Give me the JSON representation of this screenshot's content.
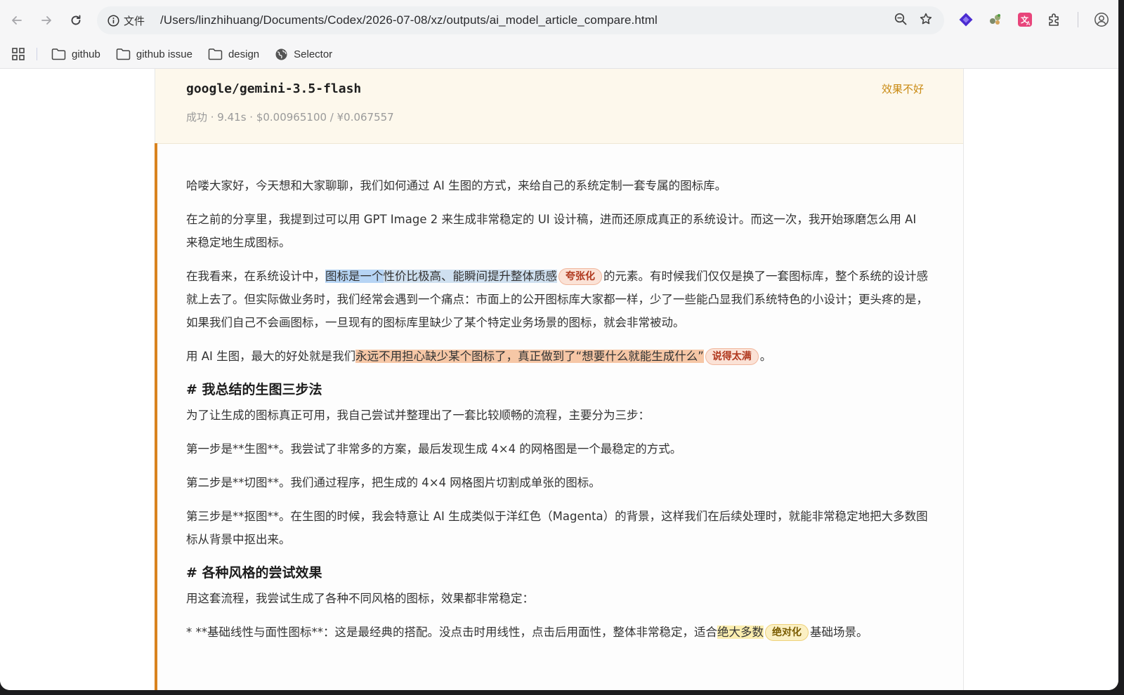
{
  "browser": {
    "scheme_label": "文件",
    "url": "/Users/linzhihuang/Documents/Codex/2026-07-08/xz/outputs/ai_model_article_compare.html"
  },
  "bookmarks": [
    {
      "label": "github",
      "icon": "folder-icon"
    },
    {
      "label": "github issue",
      "icon": "folder-icon"
    },
    {
      "label": "design",
      "icon": "folder-icon"
    },
    {
      "label": "Selector",
      "icon": "globe-icon"
    }
  ],
  "card": {
    "model": "google/gemini-3.5-flash",
    "verdict": "效果不好",
    "verdict_color": "#c98a12",
    "meta": "成功 · 9.41s · $0.00965100 / ¥0.067557",
    "accent_color": "#d9831f"
  },
  "article": {
    "p1": "哈喽大家好，今天想和大家聊聊，我们如何通过 AI 生图的方式，来给自己的系统定制一套专属的图标库。",
    "p2": "在之前的分享里，我提到过可以用 GPT Image 2 来生成非常稳定的 UI 设计稿，进而还原成真正的系统设计。而这一次，我开始琢磨怎么用 AI 来稳定地生成图标。",
    "p3": {
      "pre": "在我看来，在系统设计中，",
      "hl1": "图标是一个",
      "hl2": "性价比极高、能瞬间提升整体质感",
      "tag": "夸张化",
      "post": "的元素。有时候我们仅仅是换了一套图标库，整个系统的设计感就上去了。但实际做业务时，我们经常会遇到一个痛点：市面上的公开图标库大家都一样，少了一些能凸显我们系统特色的小设计；更头疼的是，如果我们自己不会画图标，一旦现有的图标库里缺少了某个特定业务场景的图标，就会非常被动。"
    },
    "p4": {
      "pre": "用 AI 生图，最大的好处就是我们",
      "hl": "永远不用担心缺少某个图标了，真正做到了“想要什么就能生成什么”",
      "tag": "说得太满",
      "post": "。"
    },
    "h1": "# 我总结的生图三步法",
    "p5": "为了让生成的图标真正可用，我自己尝试并整理出了一套比较顺畅的流程，主要分为三步：",
    "p6": "第一步是**生图**。我尝试了非常多的方案，最后发现生成 4×4 的网格图是一个最稳定的方式。",
    "p7": "第二步是**切图**。我们通过程序，把生成的 4×4 网格图片切割成单张的图标。",
    "p8": "第三步是**抠图**。在生图的时候，我会特意让 AI 生成类似于洋红色（Magenta）的背景，这样我们在后续处理时，就能非常稳定地把大多数图标从背景中抠出来。",
    "h2": "# 各种风格的尝试效果",
    "p9": "用这套流程，我尝试生成了各种不同风格的图标，效果都非常稳定：",
    "p10": {
      "pre": "* **基础线性与面性图标**：这是最经典的搭配。没点击时用线性，点击后用面性，整体非常稳定，适合",
      "hl": "绝大多数",
      "tag": "绝对化",
      "post": "基础场景。"
    }
  }
}
